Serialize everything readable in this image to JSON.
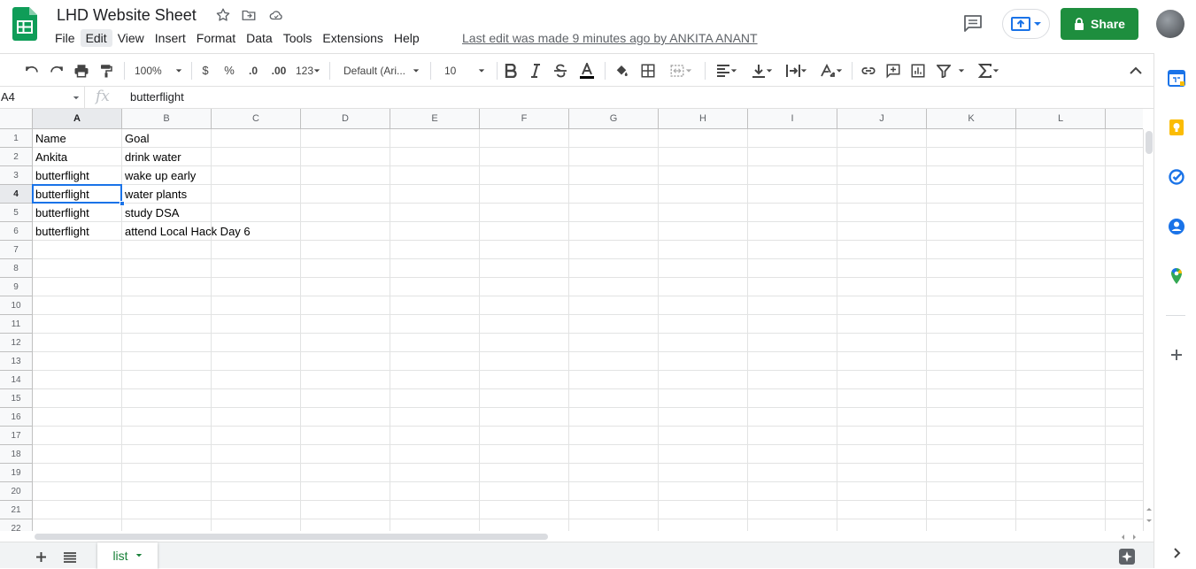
{
  "app": {
    "title": "LHD Website Sheet",
    "last_edit": "Last edit was made 9 minutes ago by ANKITA ANANT",
    "share_label": "Share",
    "brand_color": "#1e8e3e"
  },
  "menu": [
    "File",
    "Edit",
    "View",
    "Insert",
    "Format",
    "Data",
    "Tools",
    "Extensions",
    "Help"
  ],
  "toolbar": {
    "zoom": "100%",
    "currency": "$",
    "percent": "%",
    "decrease_decimal": ".0",
    "increase_decimal": ".00",
    "more_formats": "123",
    "font": "Default (Ari...",
    "font_size": "10"
  },
  "formula_bar": {
    "cell_ref": "A4",
    "fx": "fx",
    "value": "butterflight"
  },
  "columns": [
    "A",
    "B",
    "C",
    "D",
    "E",
    "F",
    "G",
    "H",
    "I",
    "J",
    "K",
    "L"
  ],
  "row_numbers": [
    "1",
    "2",
    "3",
    "4",
    "5",
    "6",
    "7",
    "8",
    "9",
    "10",
    "11",
    "12",
    "13",
    "14",
    "15",
    "16",
    "17",
    "18",
    "19",
    "20",
    "21",
    "22"
  ],
  "rows": [
    [
      "Name",
      "Goal"
    ],
    [
      "Ankita",
      "drink water"
    ],
    [
      "butterflight",
      "wake up early"
    ],
    [
      "butterflight",
      "water plants"
    ],
    [
      "butterflight",
      "study DSA"
    ],
    [
      "butterflight",
      "attend Local Hack Day 6"
    ]
  ],
  "selected_cell": "A4",
  "sheets": [
    {
      "name": "list",
      "active": true
    }
  ],
  "icons": {
    "side_panel": [
      "calendar-icon",
      "keep-icon",
      "tasks-icon",
      "contacts-icon",
      "maps-icon",
      "add-addon-icon",
      "expand-panel-icon"
    ]
  }
}
